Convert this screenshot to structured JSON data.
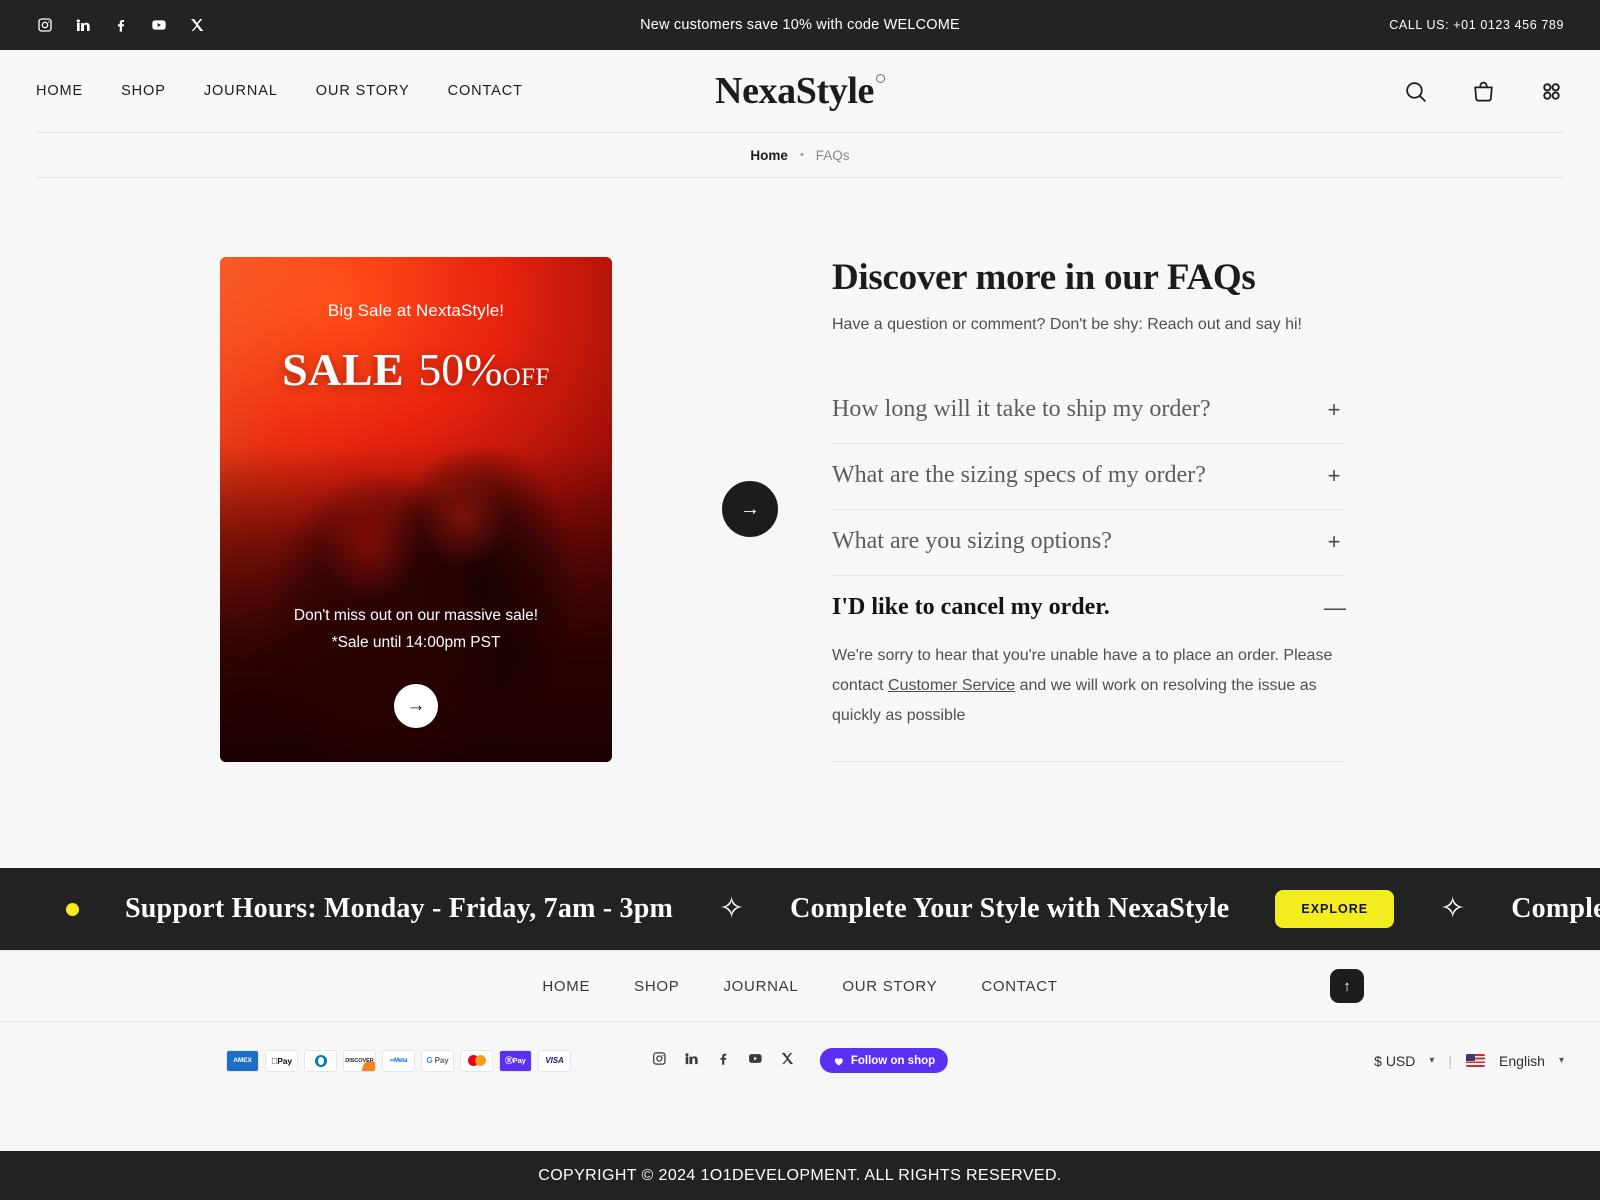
{
  "announcement": {
    "message": "New customers save 10% with code WELCOME",
    "phone": "CALL US: +01 0123 456 789",
    "socials": [
      {
        "name": "instagram-icon",
        "label": "Instagram"
      },
      {
        "name": "linkedin-icon",
        "label": "LinkedIn"
      },
      {
        "name": "facebook-icon",
        "label": "Facebook"
      },
      {
        "name": "youtube-icon",
        "label": "YouTube"
      },
      {
        "name": "x-icon",
        "label": "X"
      }
    ]
  },
  "header": {
    "nav": [
      "HOME",
      "SHOP",
      "JOURNAL",
      "OUR STORY",
      "CONTACT"
    ],
    "logo": "NexaStyle",
    "icons": [
      "search-icon",
      "cart-icon",
      "grid-menu-icon"
    ]
  },
  "breadcrumb": {
    "home": "Home",
    "separator": "•",
    "current": "FAQs"
  },
  "promo": {
    "kicker": "Big Sale at NextaStyle!",
    "sale_word": "SALE",
    "sale_percent": "50%",
    "sale_off": "OFF",
    "line1": "Don't miss out on our massive sale!",
    "line2": "*Sale until 14:00pm PST",
    "cta_arrow": "→",
    "prev_arrow": "←",
    "next_arrow": "→"
  },
  "faq": {
    "title": "Discover more in our FAQs",
    "subtitle": "Have a question or comment? Don't be shy: Reach out and say hi!",
    "items": [
      {
        "question": "How long will it take to ship my order?",
        "sign": "+",
        "open": false,
        "answer": ""
      },
      {
        "question": "What are the sizing specs of my order?",
        "sign": "+",
        "open": false,
        "answer": ""
      },
      {
        "question": "What are you sizing options?",
        "sign": "+",
        "open": false,
        "answer": ""
      },
      {
        "question": "I'D like to cancel my order.",
        "sign": "—",
        "open": true,
        "answer_before": "We're sorry to hear that you're unable have a to place an order. Please contact ",
        "answer_link": "Customer Service",
        "answer_after": " and we will work on resolving the issue as quickly as possible"
      }
    ]
  },
  "marquee": {
    "support_hours": "Support Hours: Monday - Friday, 7am - 3pm",
    "complete_style": "Complete Your Style with NexaStyle",
    "explore_label": "EXPLORE",
    "complete_style_2": "Complete Your",
    "star": "✧",
    "dot_color": "#f3ed1f"
  },
  "footer": {
    "nav": [
      "HOME",
      "SHOP",
      "JOURNAL",
      "OUR STORY",
      "CONTACT"
    ],
    "back_to_top": "↑",
    "payments": [
      "AMEX",
      "Apple Pay",
      "Diners Club",
      "DISCOVER",
      "Meta Pay",
      "G Pay",
      "Mastercard",
      "Shop Pay",
      "VISA"
    ],
    "socials": [
      "instagram-icon",
      "linkedin-icon",
      "facebook-icon",
      "youtube-icon",
      "x-icon"
    ],
    "shop_button": "Follow on shop",
    "currency": "$ USD",
    "language": "English",
    "divider": "|",
    "copyright": "COPYRIGHT © 2024 1O1DEVELOPMENT. ALL RIGHTS RESERVED."
  }
}
